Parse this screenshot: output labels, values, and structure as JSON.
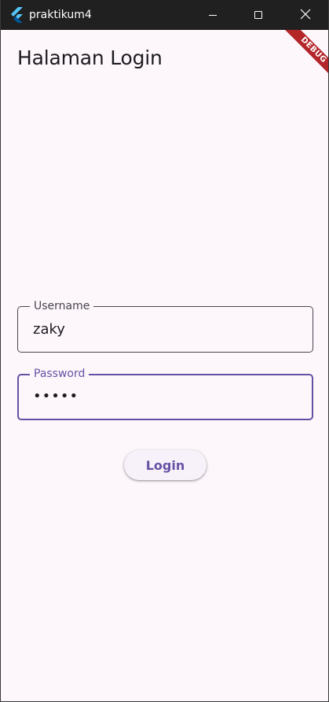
{
  "window": {
    "title": "praktikum4",
    "app_icon": "flutter-logo-icon",
    "controls": {
      "minimize_icon": "minimize-icon",
      "maximize_icon": "maximize-icon",
      "close_icon": "close-icon"
    }
  },
  "debug_banner": {
    "label": "DEBUG",
    "color": "#b3262a"
  },
  "page": {
    "title": "Halaman Login"
  },
  "form": {
    "username": {
      "label": "Username",
      "value": "zaky"
    },
    "password": {
      "label": "Password",
      "value": "•••••",
      "focused": true
    },
    "login_label": "Login"
  },
  "colors": {
    "background": "#fdf7fc",
    "primary": "#6750a4",
    "titlebar": "#202020",
    "text": "#1d1b20",
    "outline": "#49454f"
  }
}
